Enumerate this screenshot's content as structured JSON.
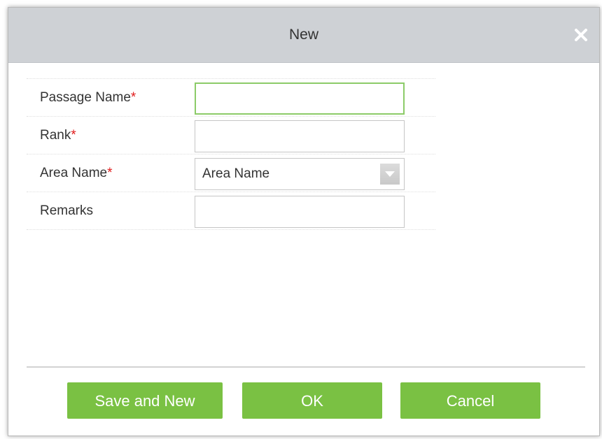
{
  "dialog": {
    "title": "New",
    "close_icon": "close-icon"
  },
  "form": {
    "passage_name": {
      "label": "Passage Name",
      "required_mark": "*",
      "value": ""
    },
    "rank": {
      "label": "Rank",
      "required_mark": "*",
      "value": ""
    },
    "area_name": {
      "label": "Area Name",
      "required_mark": "*",
      "selected": "Area Name",
      "dropdown_icon": "chevron-down-icon"
    },
    "remarks": {
      "label": "Remarks",
      "value": ""
    }
  },
  "buttons": {
    "save_and_new": "Save and New",
    "ok": "OK",
    "cancel": "Cancel"
  },
  "colors": {
    "titlebar": "#ced1d5",
    "button_green": "#7ac143",
    "required_red": "#e01b1b",
    "focus_border": "#8ccb68"
  }
}
